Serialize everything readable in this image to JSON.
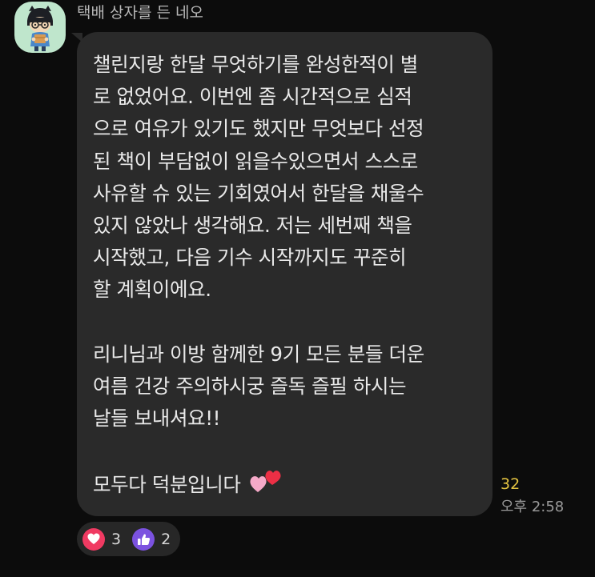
{
  "chat": {
    "sender_name": "택배 상자를 든 네오",
    "message_text": "챌린지랑 한달 무엇하기를 완성한적이 별\n로 없었어요. 이번엔 좀 시간적으로 심적\n으로 여유가 있기도 했지만 무엇보다 선정\n된 책이 부담없이 읽을수있으면서 스스로\n사유할 슈 있는 기회였어서 한달을 채울수\n있지 않았나 생각해요. 저는 세번째 책을\n시작했고, 다음 기수 시작까지도 꾸준히\n할 계획이에요.\n\n리니님과 이방 함께한 9기 모든 분들 더운\n여름 건강 주의하시궁 즐독 즐필 하시는\n날들 보내셔요!!\n\n모두다 덕분입니다 ",
    "emoji_icon": "hearts-icon",
    "unread_count": "32",
    "timestamp": "오후 2:58",
    "reactions": [
      {
        "icon": "heart-icon",
        "color": "#f03a62",
        "count": "3"
      },
      {
        "icon": "thumbs-up-icon",
        "color": "#7b52e0",
        "count": "2"
      }
    ]
  },
  "colors": {
    "background": "#0c0c0c",
    "bubble": "#2a2a2a",
    "avatar_bg": "#bfe6cc",
    "unread_accent": "#e5c441"
  }
}
